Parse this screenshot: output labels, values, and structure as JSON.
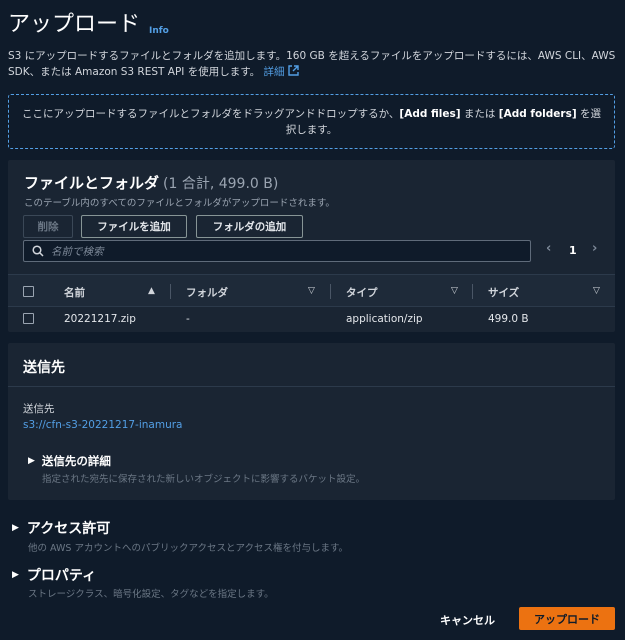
{
  "header": {
    "title": "アップロード",
    "info_label": "Info"
  },
  "description": {
    "text": "S3 にアップロードするファイルとフォルダを追加します。160 GB を超えるファイルをアップロードするには、AWS CLI、AWS SDK、または Amazon S3 REST API を使用します。",
    "link_label": "詳細"
  },
  "dropzone": {
    "text_before": "ここにアップロードするファイルとフォルダをドラッグアンドドロップするか、",
    "add_files": "[Add files]",
    "text_middle": " または ",
    "add_folders": "[Add folders]",
    "text_after": " を選択します。"
  },
  "files": {
    "title": "ファイルとフォルダ",
    "count": "(1 合計, 499.0 B)",
    "subtitle": "このテーブル内のすべてのファイルとフォルダがアップロードされます。",
    "delete_label": "削除",
    "add_files_label": "ファイルを追加",
    "add_folder_label": "フォルダの追加",
    "search_placeholder": "名前で検索",
    "page_number": "1",
    "columns": [
      "名前",
      "フォルダ",
      "タイプ",
      "サイズ"
    ],
    "rows": [
      {
        "name": "20221217.zip",
        "folder": "-",
        "type": "application/zip",
        "size": "499.0 B"
      }
    ]
  },
  "destination": {
    "section_title": "送信先",
    "label": "送信先",
    "uri": "s3://cfn-s3-20221217-inamura",
    "details_title": "送信先の詳細",
    "details_sub": "指定された宛先に保存された新しいオブジェクトに影響するバケット設定。"
  },
  "permissions": {
    "title": "アクセス許可",
    "sub": "他の AWS アカウントへのパブリックアクセスとアクセス権を付与します。"
  },
  "properties": {
    "title": "プロパティ",
    "sub": "ストレージクラス、暗号化設定、タグなどを指定します。"
  },
  "footer": {
    "cancel_label": "キャンセル",
    "upload_label": "アップロード"
  },
  "colors": {
    "background": "#0f1b2a",
    "panel": "#1a2533",
    "link": "#539fe5",
    "primary": "#ec7211"
  }
}
